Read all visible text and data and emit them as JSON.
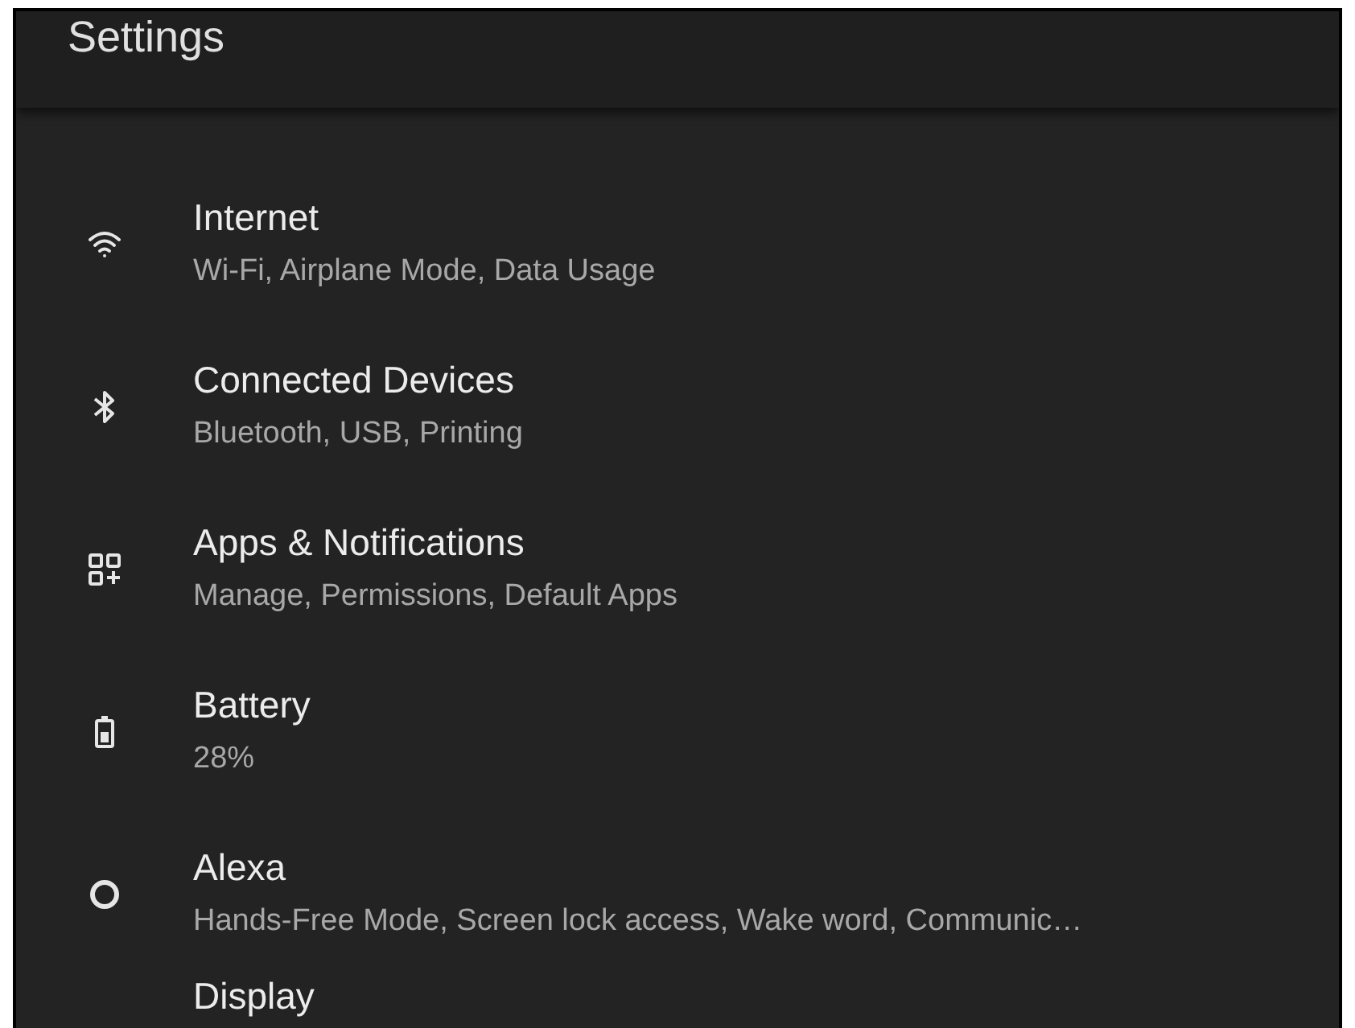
{
  "app_bar": {
    "title": "Settings"
  },
  "settings": [
    {
      "kind": "wifi",
      "title": "Internet",
      "subtitle": "Wi-Fi, Airplane Mode, Data Usage"
    },
    {
      "kind": "bluetooth",
      "title": "Connected Devices",
      "subtitle": "Bluetooth, USB, Printing"
    },
    {
      "kind": "apps",
      "title": "Apps & Notifications",
      "subtitle": "Manage, Permissions, Default Apps"
    },
    {
      "kind": "battery",
      "title": "Battery",
      "subtitle": "28%"
    },
    {
      "kind": "alexa",
      "title": "Alexa",
      "subtitle": "Hands-Free Mode, Screen lock access, Wake word, Communic…"
    },
    {
      "kind": "display",
      "title": "Display"
    }
  ]
}
